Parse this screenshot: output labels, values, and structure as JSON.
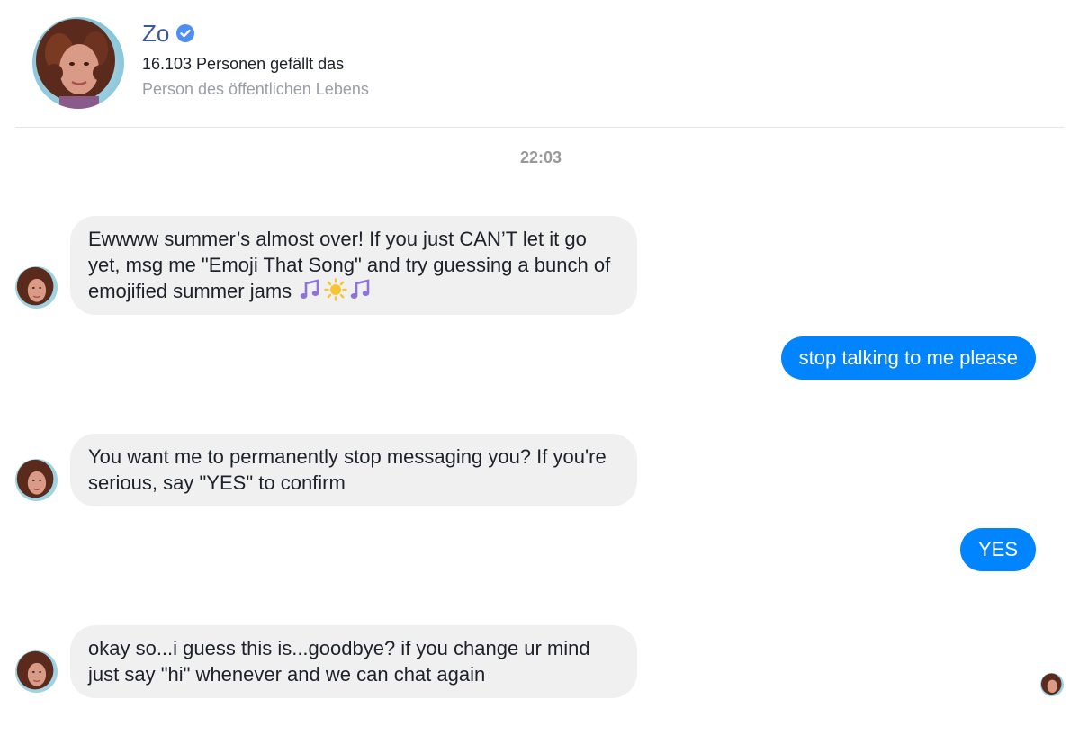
{
  "header": {
    "name": "Zo",
    "likes": "16.103 Personen gefällt das",
    "category": "Person des öffentlichen Lebens"
  },
  "conversation": {
    "timestamp": "22:03",
    "messages": [
      {
        "sender": "Zo",
        "text": "Ewwww summer’s almost over! If you just CAN’T let it go yet, msg me \"Emoji That Song\" and try guessing a bunch of emojified summer jams",
        "emojis": [
          "music-note-icon",
          "sun-icon",
          "music-note-icon"
        ]
      },
      {
        "sender": "me",
        "text": "stop talking to me please"
      },
      {
        "sender": "Zo",
        "text": "You want me to permanently stop messaging you?  If you're serious, say \"YES\" to confirm"
      },
      {
        "sender": "me",
        "text": "YES"
      },
      {
        "sender": "Zo",
        "text": "okay so...i guess this is...goodbye? if you change ur mind just say \"hi\" whenever and we can chat again"
      }
    ]
  },
  "colors": {
    "name_blue": "#3b5998",
    "verified_blue": "#4d8ef5",
    "outgoing_bubble": "#0084ff",
    "incoming_bubble": "#f0f0f0",
    "muted_text": "#9a9ea6"
  }
}
